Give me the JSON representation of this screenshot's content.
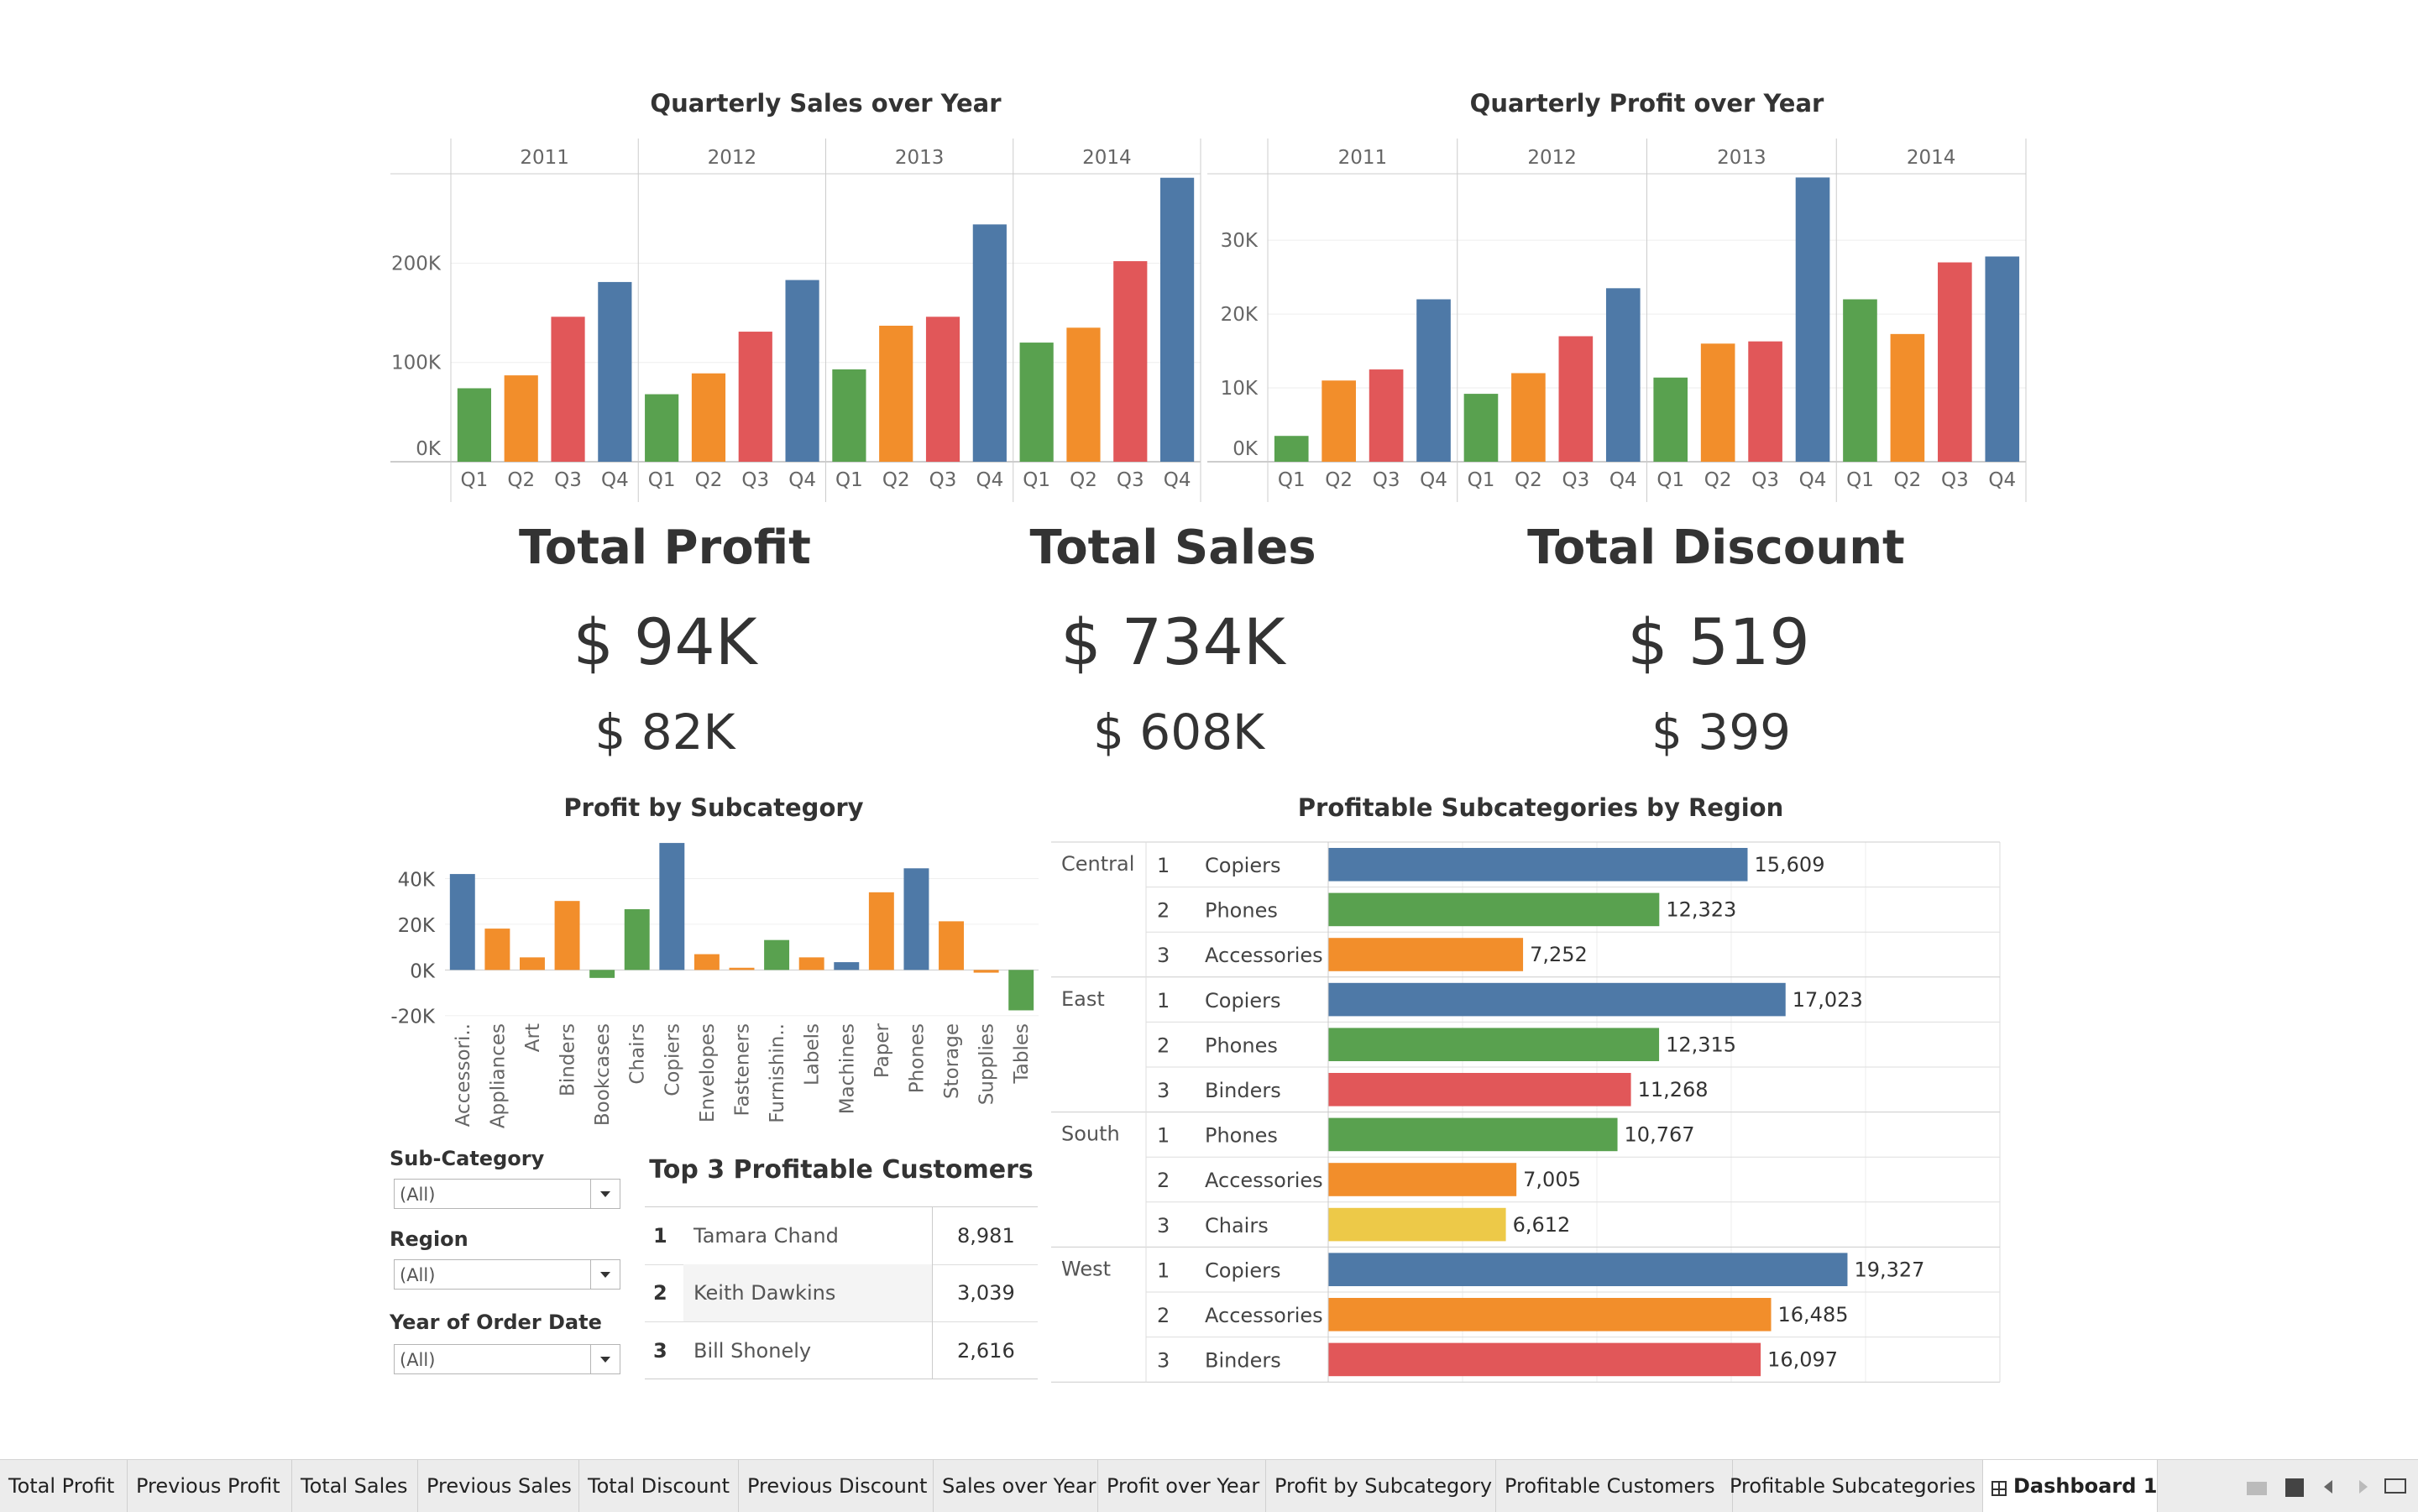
{
  "sales_chart": {
    "title": "Quarterly Sales over Year",
    "years": [
      "2011",
      "2012",
      "2013",
      "2014"
    ],
    "quarters": [
      "Q1",
      "Q2",
      "Q3",
      "Q4"
    ],
    "y_ticks": [
      "0K",
      "100K",
      "200K"
    ],
    "ylim": [
      0,
      290000
    ],
    "values": [
      [
        74000,
        87000,
        146000,
        181000
      ],
      [
        68000,
        89000,
        131000,
        183000
      ],
      [
        93000,
        137000,
        146000,
        239000
      ],
      [
        120000,
        135000,
        202000,
        286000
      ]
    ]
  },
  "profit_chart": {
    "title": "Quarterly Profit over Year",
    "years": [
      "2011",
      "2012",
      "2013",
      "2014"
    ],
    "quarters": [
      "Q1",
      "Q2",
      "Q3",
      "Q4"
    ],
    "y_ticks": [
      "0K",
      "10K",
      "20K",
      "30K"
    ],
    "ylim": [
      0,
      39000
    ],
    "values": [
      [
        3500,
        11000,
        12500,
        22000
      ],
      [
        9200,
        12000,
        17000,
        23500
      ],
      [
        11400,
        16000,
        16300,
        38500
      ],
      [
        22000,
        17300,
        27000,
        27800
      ]
    ]
  },
  "kpis": [
    {
      "title": "Total Profit",
      "current": "$ 94K",
      "previous": "$ 82K"
    },
    {
      "title": "Total Sales",
      "current": "$ 734K",
      "previous": "$ 608K"
    },
    {
      "title": "Total Discount",
      "current": "$ 519",
      "previous": "$ 399"
    }
  ],
  "subcat_chart": {
    "title": "Profit by Subcategory",
    "y_ticks": [
      "40K",
      "20K",
      "0K",
      "-20K"
    ],
    "ylim": [
      -19000,
      56000
    ],
    "categories": [
      "Accessori..",
      "Appliances",
      "Art",
      "Binders",
      "Bookcases",
      "Chairs",
      "Copiers",
      "Envelopes",
      "Fasteners",
      "Furnishin..",
      "Labels",
      "Machines",
      "Paper",
      "Phones",
      "Storage",
      "Supplies",
      "Tables"
    ],
    "values": [
      42000,
      18100,
      5500,
      30200,
      -3500,
      26600,
      55600,
      6900,
      950,
      13100,
      5500,
      3400,
      34000,
      44500,
      21300,
      -1200,
      -17700
    ],
    "colors": [
      "#4e79a7",
      "#f28e2b",
      "#f28e2b",
      "#f28e2b",
      "#59a14f",
      "#59a14f",
      "#4e79a7",
      "#f28e2b",
      "#f28e2b",
      "#59a14f",
      "#f28e2b",
      "#4e79a7",
      "#f28e2b",
      "#4e79a7",
      "#f28e2b",
      "#f28e2b",
      "#59a14f"
    ]
  },
  "region_chart": {
    "title": "Profitable Subcategories by Region",
    "xmax": 25000,
    "regions": [
      {
        "name": "Central",
        "rows": [
          {
            "rank": "1",
            "sub": "Copiers",
            "value": 15609,
            "label": "15,609",
            "color": "#4e79a7"
          },
          {
            "rank": "2",
            "sub": "Phones",
            "value": 12323,
            "label": "12,323",
            "color": "#59a14f"
          },
          {
            "rank": "3",
            "sub": "Accessories",
            "value": 7252,
            "label": "7,252",
            "color": "#f28e2b"
          }
        ]
      },
      {
        "name": "East",
        "rows": [
          {
            "rank": "1",
            "sub": "Copiers",
            "value": 17023,
            "label": "17,023",
            "color": "#4e79a7"
          },
          {
            "rank": "2",
            "sub": "Phones",
            "value": 12315,
            "label": "12,315",
            "color": "#59a14f"
          },
          {
            "rank": "3",
            "sub": "Binders",
            "value": 11268,
            "label": "11,268",
            "color": "#e15759"
          }
        ]
      },
      {
        "name": "South",
        "rows": [
          {
            "rank": "1",
            "sub": "Phones",
            "value": 10767,
            "label": "10,767",
            "color": "#59a14f"
          },
          {
            "rank": "2",
            "sub": "Accessories",
            "value": 7005,
            "label": "7,005",
            "color": "#f28e2b"
          },
          {
            "rank": "3",
            "sub": "Chairs",
            "value": 6612,
            "label": "6,612",
            "color": "#edc948"
          }
        ]
      },
      {
        "name": "West",
        "rows": [
          {
            "rank": "1",
            "sub": "Copiers",
            "value": 19327,
            "label": "19,327",
            "color": "#4e79a7"
          },
          {
            "rank": "2",
            "sub": "Accessories",
            "value": 16485,
            "label": "16,485",
            "color": "#f28e2b"
          },
          {
            "rank": "3",
            "sub": "Binders",
            "value": 16097,
            "label": "16,097",
            "color": "#e15759"
          }
        ]
      }
    ]
  },
  "filters": [
    {
      "label": "Sub-Category",
      "value": "(All)"
    },
    {
      "label": "Region",
      "value": "(All)"
    },
    {
      "label": "Year of Order Date",
      "value": "(All)"
    }
  ],
  "customers": {
    "title": "Top 3 Profitable Customers",
    "rows": [
      {
        "rank": "1",
        "name": "Tamara Chand",
        "value": "8,981"
      },
      {
        "rank": "2",
        "name": "Keith Dawkins",
        "value": "3,039"
      },
      {
        "rank": "3",
        "name": "Bill Shonely",
        "value": "2,616"
      }
    ]
  },
  "tabs": [
    "Total Profit",
    "Previous Profit",
    "Total Sales",
    "Previous Sales",
    "Total Discount",
    "Previous Discount",
    "Sales over Year",
    "Profit over Year",
    "Profit by Subcategory",
    "Profitable Customers",
    "Profitable Subcategories",
    "Dashboard 1"
  ],
  "colors": {
    "q1": "#59a14f",
    "q2": "#f28e2b",
    "q3": "#e15759",
    "q4": "#4e79a7"
  }
}
